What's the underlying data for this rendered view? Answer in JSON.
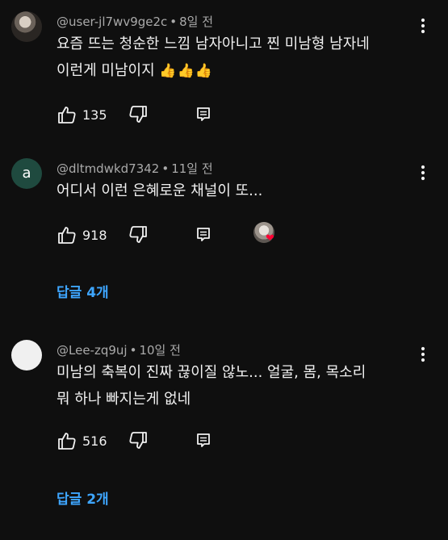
{
  "comments": [
    {
      "author": "@user-jl7wv9ge2c",
      "time": "8일 전",
      "lines": [
        "요즘 뜨는 청순한 느낌 남자아니고 찐 미남형 남자네",
        "이런게 미남이지"
      ],
      "emoji": "👍👍👍",
      "likes": "135",
      "avatar": "photo"
    },
    {
      "author": "@dltmdwkd7342",
      "time": "11일 전",
      "lines": [
        "어디서 이런 은혜로운 채널이 또..."
      ],
      "likes": "918",
      "avatar_letter": "a",
      "creator_heart": true,
      "replies_label": "답글 4개"
    },
    {
      "author": "@Lee-zq9uj",
      "time": "10일 전",
      "lines": [
        "미남의 축복이 진짜 끊이질 않노... 얼굴, 몸, 목소리",
        "뭐 하나 빠지는게 없네"
      ],
      "likes": "516",
      "avatar": "blank",
      "replies_label": "답글 2개"
    }
  ],
  "icons": {
    "like": "thumbs-up-icon",
    "dislike": "thumbs-down-icon",
    "reply": "reply-comment-icon",
    "more": "more-vertical-icon",
    "heart": "heart-icon"
  },
  "colors": {
    "background": "#0f0f0f",
    "text": "#f1f1f1",
    "meta": "#aaaaaa",
    "replies": "#3ea6ff",
    "heart": "#ff0033"
  }
}
